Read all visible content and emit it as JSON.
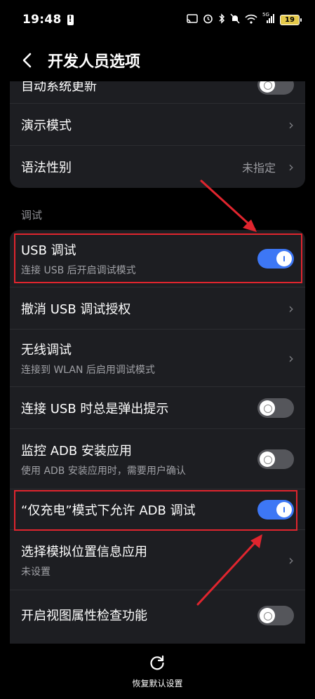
{
  "status_bar": {
    "time": "19:48",
    "network_label": "5G",
    "battery": "19"
  },
  "header": {
    "title": "开发人员选项"
  },
  "top_card": {
    "items": [
      {
        "title": "自动系统更新"
      },
      {
        "title": "演示模式"
      },
      {
        "title": "语法性别",
        "value": "未指定"
      }
    ]
  },
  "section": {
    "debug_label": "调试"
  },
  "debug_card": {
    "items": [
      {
        "title": "USB 调试",
        "subtitle": "连接 USB 后开启调试模式",
        "toggle": "on"
      },
      {
        "title": "撤消 USB 调试授权"
      },
      {
        "title": "无线调试",
        "subtitle": "连接到 WLAN 后启用调试模式"
      },
      {
        "title": "连接 USB 时总是弹出提示",
        "toggle": "off"
      },
      {
        "title": "监控 ADB 安装应用",
        "subtitle": "使用 ADB 安装应用时，需要用户确认",
        "toggle": "off"
      },
      {
        "title": "“仅充电”模式下允许 ADB 调试",
        "toggle": "on"
      },
      {
        "title": "选择模拟位置信息应用",
        "subtitle": "未设置"
      },
      {
        "title": "开启视图属性检查功能",
        "toggle": "off"
      }
    ]
  },
  "bottom": {
    "reset_label": "恢复默认设置"
  },
  "colors": {
    "accent": "#3d77f5",
    "annotation": "#e0252e",
    "card": "#1d1e22"
  }
}
